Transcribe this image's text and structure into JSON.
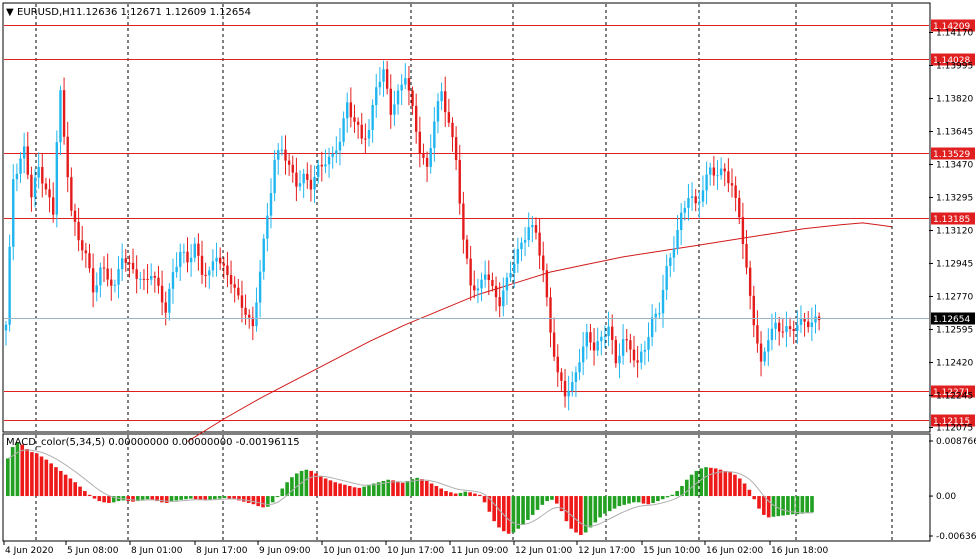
{
  "header": {
    "menu_glyph": "▼",
    "symbol_timeframe": "EURUSD,H1",
    "ohlc": "1.12636 1.12671 1.12609 1.12654"
  },
  "indicator": {
    "label": "MACD_color(5,34,5) 0.00000000 0.00000000 -0.00196115",
    "scale": [
      "0.0087666",
      "0.00",
      "-0.0063603"
    ]
  },
  "colors": {
    "bull": "#1fb6ef",
    "bear": "#e41b1b",
    "level": "#e02020",
    "ma": "#d11a1a",
    "hist_pos": "#22a022",
    "hist_neg": "#ee1a1a",
    "grid": "#000000",
    "current": "#9bb5c8"
  },
  "chart_data": {
    "type": "candlestick",
    "symbol": "EURUSD",
    "timeframe": "H1",
    "price_ticks": [
      "1.14170",
      "1.13995",
      "1.13820",
      "1.13645",
      "1.13470",
      "1.13295",
      "1.13120",
      "1.12945",
      "1.12770",
      "1.12595",
      "1.12420",
      "1.12245",
      "1.12075"
    ],
    "price_tick_values": [
      1.1417,
      1.13995,
      1.1382,
      1.13645,
      1.1347,
      1.13295,
      1.1312,
      1.12945,
      1.1277,
      1.12595,
      1.1242,
      1.12245,
      1.12075
    ],
    "ylim": [
      1.1204,
      1.1436
    ],
    "time_labels": [
      "4 Jun 2020",
      "5 Jun 08:00",
      "8 Jun 01:00",
      "8 Jun 17:00",
      "9 Jun 09:00",
      "10 Jun 01:00",
      "10 Jun 17:00",
      "11 Jun 09:00",
      "12 Jun 01:00",
      "12 Jun 17:00",
      "15 Jun 10:00",
      "16 Jun 02:00",
      "16 Jun 18:00"
    ],
    "levels": [
      {
        "value": 1.14209,
        "label": "1.14209"
      },
      {
        "value": 1.14028,
        "label": "1.14028"
      },
      {
        "value": 1.13529,
        "label": "1.13529"
      },
      {
        "value": 1.13185,
        "label": "1.13185"
      },
      {
        "value": 1.12271,
        "label": "1.12271"
      },
      {
        "value": 1.12115,
        "label": "1.12115"
      }
    ],
    "current_price": {
      "value": 1.12654,
      "label": "1.12654"
    },
    "ma_points": [
      [
        50,
        1.12
      ],
      [
        60,
        1.1212
      ],
      [
        70,
        1.1223
      ],
      [
        80,
        1.1233
      ],
      [
        90,
        1.1243
      ],
      [
        100,
        1.1253
      ],
      [
        110,
        1.1262
      ],
      [
        120,
        1.127
      ],
      [
        130,
        1.1278
      ],
      [
        140,
        1.1284
      ],
      [
        150,
        1.129
      ],
      [
        160,
        1.1294
      ],
      [
        170,
        1.1298
      ],
      [
        180,
        1.1301
      ],
      [
        190,
        1.1304
      ],
      [
        200,
        1.1307
      ],
      [
        210,
        1.131
      ],
      [
        220,
        1.1313
      ],
      [
        230,
        1.1315
      ],
      [
        236,
        1.1316
      ],
      [
        240,
        1.1315
      ],
      [
        244,
        1.1314
      ]
    ],
    "close_path": [
      [
        0,
        1.1261
      ],
      [
        2,
        1.134
      ],
      [
        5,
        1.1355
      ],
      [
        7,
        1.133
      ],
      [
        9,
        1.1345
      ],
      [
        11,
        1.1335
      ],
      [
        13,
        1.132
      ],
      [
        14,
        1.136
      ],
      [
        15,
        1.1385
      ],
      [
        16,
        1.136
      ],
      [
        18,
        1.1325
      ],
      [
        20,
        1.1305
      ],
      [
        22,
        1.13
      ],
      [
        24,
        1.128
      ],
      [
        26,
        1.1292
      ],
      [
        28,
        1.1286
      ],
      [
        30,
        1.1282
      ],
      [
        32,
        1.13
      ],
      [
        34,
        1.1292
      ],
      [
        36,
        1.1288
      ],
      [
        38,
        1.1285
      ],
      [
        40,
        1.129
      ],
      [
        42,
        1.128
      ],
      [
        44,
        1.127
      ],
      [
        46,
        1.129
      ],
      [
        48,
        1.13
      ],
      [
        50,
        1.1295
      ],
      [
        52,
        1.1305
      ],
      [
        54,
        1.129
      ],
      [
        56,
        1.1288
      ],
      [
        58,
        1.13
      ],
      [
        60,
        1.1292
      ],
      [
        62,
        1.1285
      ],
      [
        64,
        1.1275
      ],
      [
        66,
        1.127
      ],
      [
        68,
        1.126
      ],
      [
        70,
        1.129
      ],
      [
        72,
        1.132
      ],
      [
        74,
        1.135
      ],
      [
        76,
        1.1355
      ],
      [
        78,
        1.1345
      ],
      [
        80,
        1.1338
      ],
      [
        82,
        1.134
      ],
      [
        84,
        1.1335
      ],
      [
        86,
        1.1345
      ],
      [
        88,
        1.135
      ],
      [
        90,
        1.135
      ],
      [
        92,
        1.136
      ],
      [
        94,
        1.138
      ],
      [
        96,
        1.137
      ],
      [
        98,
        1.136
      ],
      [
        100,
        1.1365
      ],
      [
        102,
        1.139
      ],
      [
        104,
        1.1395
      ],
      [
        106,
        1.1375
      ],
      [
        108,
        1.1385
      ],
      [
        110,
        1.1395
      ],
      [
        112,
        1.1375
      ],
      [
        114,
        1.1355
      ],
      [
        116,
        1.1345
      ],
      [
        118,
        1.137
      ],
      [
        120,
        1.1385
      ],
      [
        122,
        1.137
      ],
      [
        124,
        1.135
      ],
      [
        126,
        1.1305
      ],
      [
        128,
        1.1285
      ],
      [
        130,
        1.128
      ],
      [
        132,
        1.129
      ],
      [
        134,
        1.128
      ],
      [
        136,
        1.1275
      ],
      [
        138,
        1.1285
      ],
      [
        140,
        1.1295
      ],
      [
        142,
        1.1305
      ],
      [
        144,
        1.1315
      ],
      [
        146,
        1.131
      ],
      [
        148,
        1.129
      ],
      [
        150,
        1.126
      ],
      [
        152,
        1.1235
      ],
      [
        154,
        1.1225
      ],
      [
        156,
        1.123
      ],
      [
        158,
        1.1245
      ],
      [
        160,
        1.1255
      ],
      [
        162,
        1.125
      ],
      [
        164,
        1.1255
      ],
      [
        166,
        1.1262
      ],
      [
        168,
        1.124
      ],
      [
        170,
        1.1255
      ],
      [
        172,
        1.125
      ],
      [
        174,
        1.124
      ],
      [
        176,
        1.125
      ],
      [
        178,
        1.1265
      ],
      [
        180,
        1.127
      ],
      [
        182,
        1.129
      ],
      [
        184,
        1.1305
      ],
      [
        186,
        1.132
      ],
      [
        188,
        1.133
      ],
      [
        190,
        1.1325
      ],
      [
        192,
        1.1335
      ],
      [
        194,
        1.1345
      ],
      [
        196,
        1.134
      ],
      [
        198,
        1.1345
      ],
      [
        200,
        1.1335
      ],
      [
        202,
        1.132
      ],
      [
        204,
        1.129
      ],
      [
        206,
        1.1265
      ],
      [
        208,
        1.124
      ],
      [
        210,
        1.1255
      ],
      [
        212,
        1.1262
      ],
      [
        214,
        1.126
      ],
      [
        216,
        1.1258
      ],
      [
        218,
        1.1262
      ],
      [
        220,
        1.1265
      ],
      [
        222,
        1.1262
      ],
      [
        224,
        1.1265
      ]
    ],
    "macd_hist": [
      0.006,
      0.0078,
      0.0086,
      0.0082,
      0.0075,
      0.007,
      0.0068,
      0.0063,
      0.0058,
      0.0052,
      0.0046,
      0.004,
      0.0034,
      0.0028,
      0.0022,
      0.0015,
      0.0008,
      0.0002,
      -0.0004,
      -0.0008,
      -0.001,
      -0.0011,
      -0.001,
      -0.0008,
      -0.0007,
      -0.0008,
      -0.0009,
      -0.0008,
      -0.0006,
      -0.0005,
      -0.0006,
      -0.0008,
      -0.001,
      -0.0011,
      -0.0009,
      -0.0007,
      -0.0006,
      -0.0005,
      -0.0004,
      -0.0005,
      -0.0006,
      -0.0007,
      -0.0006,
      -0.0005,
      -0.0004,
      -0.0003,
      -0.0004,
      -0.0005,
      -0.0007,
      -0.0009,
      -0.0011,
      -0.0013,
      -0.0016,
      -0.0018,
      -0.0017,
      -0.001,
      0.0,
      0.0012,
      0.0022,
      0.003,
      0.0036,
      0.004,
      0.0042,
      0.004,
      0.0036,
      0.0032,
      0.0028,
      0.0025,
      0.0022,
      0.002,
      0.0018,
      0.0016,
      0.0014,
      0.0013,
      0.0015,
      0.0018,
      0.002,
      0.0022,
      0.0024,
      0.0026,
      0.0025,
      0.0023,
      0.0021,
      0.0024,
      0.0027,
      0.0029,
      0.0027,
      0.0024,
      0.002,
      0.0016,
      0.0012,
      0.0008,
      0.0006,
      0.0004,
      0.0005,
      0.0007,
      0.0006,
      0.0004,
      0.0002,
      -0.001,
      -0.0025,
      -0.004,
      -0.005,
      -0.0056,
      -0.006,
      -0.0058,
      -0.0052,
      -0.0045,
      -0.0038,
      -0.003,
      -0.0022,
      -0.0014,
      -0.0008,
      -0.0006,
      -0.0012,
      -0.0024,
      -0.004,
      -0.0052,
      -0.0058,
      -0.0062,
      -0.0058,
      -0.005,
      -0.0042,
      -0.0034,
      -0.0028,
      -0.0024,
      -0.002,
      -0.0016,
      -0.0014,
      -0.0012,
      -0.001,
      -0.001,
      -0.0012,
      -0.0013,
      -0.0011,
      -0.0008,
      -0.0005,
      -0.0002,
      0.0002,
      0.0008,
      0.0016,
      0.0026,
      0.0034,
      0.004,
      0.0044,
      0.0046,
      0.0045,
      0.0044,
      0.0042,
      0.004,
      0.0038,
      0.0034,
      0.0028,
      0.002,
      0.001,
      -0.0005,
      -0.002,
      -0.003,
      -0.0034,
      -0.0033,
      -0.0032,
      -0.0031,
      -0.003,
      -0.0029,
      -0.0029,
      -0.0028,
      -0.0027,
      -0.0026
    ],
    "macd_ylim": [
      -0.0063603,
      0.0087666
    ]
  }
}
